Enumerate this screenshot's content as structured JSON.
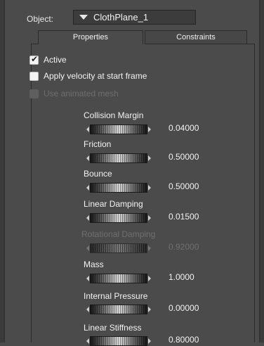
{
  "header": {
    "object_label": "Object:",
    "object_value": "ClothPlane_1"
  },
  "tabs": [
    {
      "label": "Properties",
      "active": true
    },
    {
      "label": "Constraints",
      "active": false
    }
  ],
  "checkboxes": [
    {
      "label": "Active",
      "checked": true,
      "enabled": true
    },
    {
      "label": "Apply velocity at start frame",
      "checked": false,
      "enabled": true
    },
    {
      "label": "Use animated mesh",
      "checked": false,
      "enabled": false
    }
  ],
  "params": [
    {
      "label": "Collision Margin",
      "value": "0.04000",
      "enabled": true
    },
    {
      "label": "Friction",
      "value": "0.50000",
      "enabled": true
    },
    {
      "label": "Bounce",
      "value": "0.50000",
      "enabled": true
    },
    {
      "label": "Linear Damping",
      "value": "0.01500",
      "enabled": true
    },
    {
      "label": "Rotational Damping",
      "value": "0.92000",
      "enabled": false
    },
    {
      "label": "Mass",
      "value": "1.0000",
      "enabled": true
    },
    {
      "label": "Internal Pressure",
      "value": "0.00000",
      "enabled": true
    },
    {
      "label": "Linear Stiffness",
      "value": "0.80000",
      "enabled": true
    }
  ],
  "colors": {
    "panel_bg": "#4b4b4b",
    "text": "#f2f2f2",
    "disabled_text": "#6f6f6f",
    "dropdown_bg": "#3c3c3c"
  },
  "icons": {
    "dropdown": "triangle-down-icon",
    "checkmark": "check-icon",
    "dial_arrows": "triangle-left-right-icons"
  }
}
